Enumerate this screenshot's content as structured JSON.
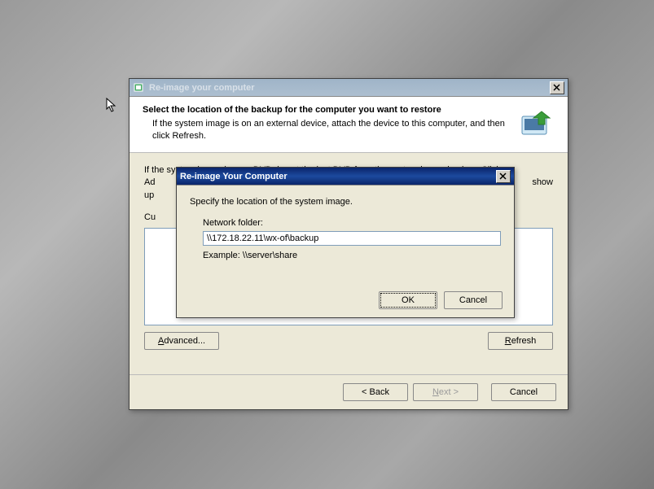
{
  "main_window": {
    "title": "Re-image your computer",
    "header_title": "Select the location of the backup for the computer you want to restore",
    "header_sub": "If the system image is on an external device, attach the device to this computer, and then click Refresh.",
    "body_line1": "If the system image is on a DVD, insert the last DVD from the system image backup. Click",
    "body_line2a": "Ad",
    "body_line2b": "show",
    "body_line3": "up",
    "current_label": "Cu",
    "advanced_btn": "Advanced...",
    "refresh_btn": "Refresh",
    "back_btn": "< Back",
    "next_btn": "Next >",
    "cancel_btn": "Cancel"
  },
  "modal": {
    "title": "Re-image Your Computer",
    "instruction": "Specify the location of the system image.",
    "field_label": "Network folder:",
    "field_value": "\\\\172.18.22.11\\wx-of\\backup",
    "example": "Example: \\\\server\\share",
    "ok_btn": "OK",
    "cancel_btn": "Cancel"
  }
}
